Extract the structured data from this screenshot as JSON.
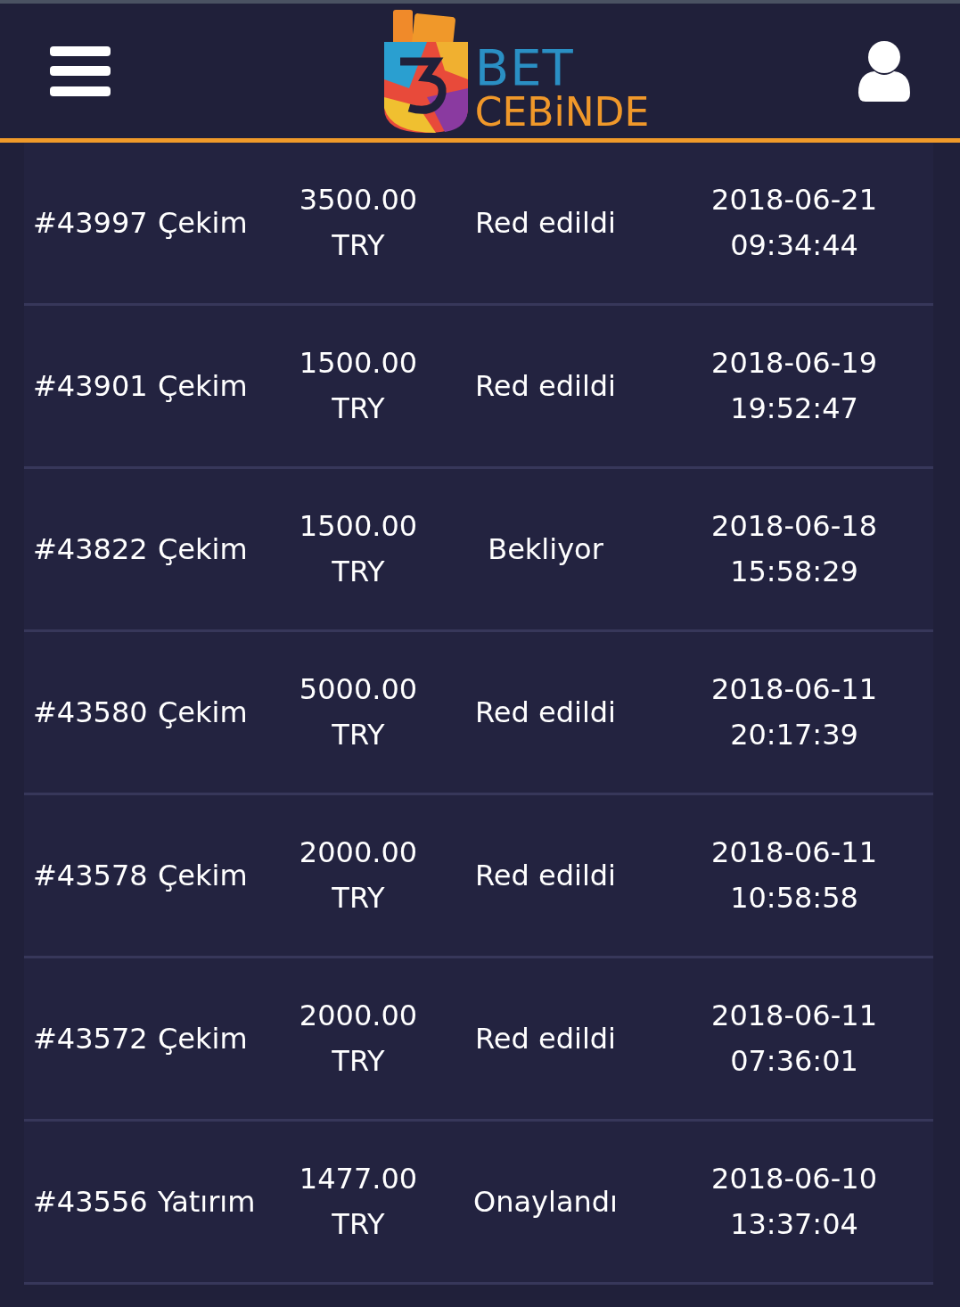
{
  "header": {
    "logo_top": "BET",
    "logo_bottom": "CEBiNDE"
  },
  "transactions": [
    {
      "id": "#43997",
      "type": "Çekim",
      "amount": "3500.00 TRY",
      "status": "Red edildi",
      "date": "2018-06-21 09:34:44"
    },
    {
      "id": "#43901",
      "type": "Çekim",
      "amount": "1500.00 TRY",
      "status": "Red edildi",
      "date": "2018-06-19 19:52:47"
    },
    {
      "id": "#43822",
      "type": "Çekim",
      "amount": "1500.00 TRY",
      "status": "Bekliyor",
      "date": "2018-06-18 15:58:29"
    },
    {
      "id": "#43580",
      "type": "Çekim",
      "amount": "5000.00 TRY",
      "status": "Red edildi",
      "date": "2018-06-11 20:17:39"
    },
    {
      "id": "#43578",
      "type": "Çekim",
      "amount": "2000.00 TRY",
      "status": "Red edildi",
      "date": "2018-06-11 10:58:58"
    },
    {
      "id": "#43572",
      "type": "Çekim",
      "amount": "2000.00 TRY",
      "status": "Red edildi",
      "date": "2018-06-11 07:36:01"
    },
    {
      "id": "#43556",
      "type": "Yatırım",
      "amount": "1477.00 TRY",
      "status": "Onaylandı",
      "date": "2018-06-10 13:37:04"
    }
  ]
}
